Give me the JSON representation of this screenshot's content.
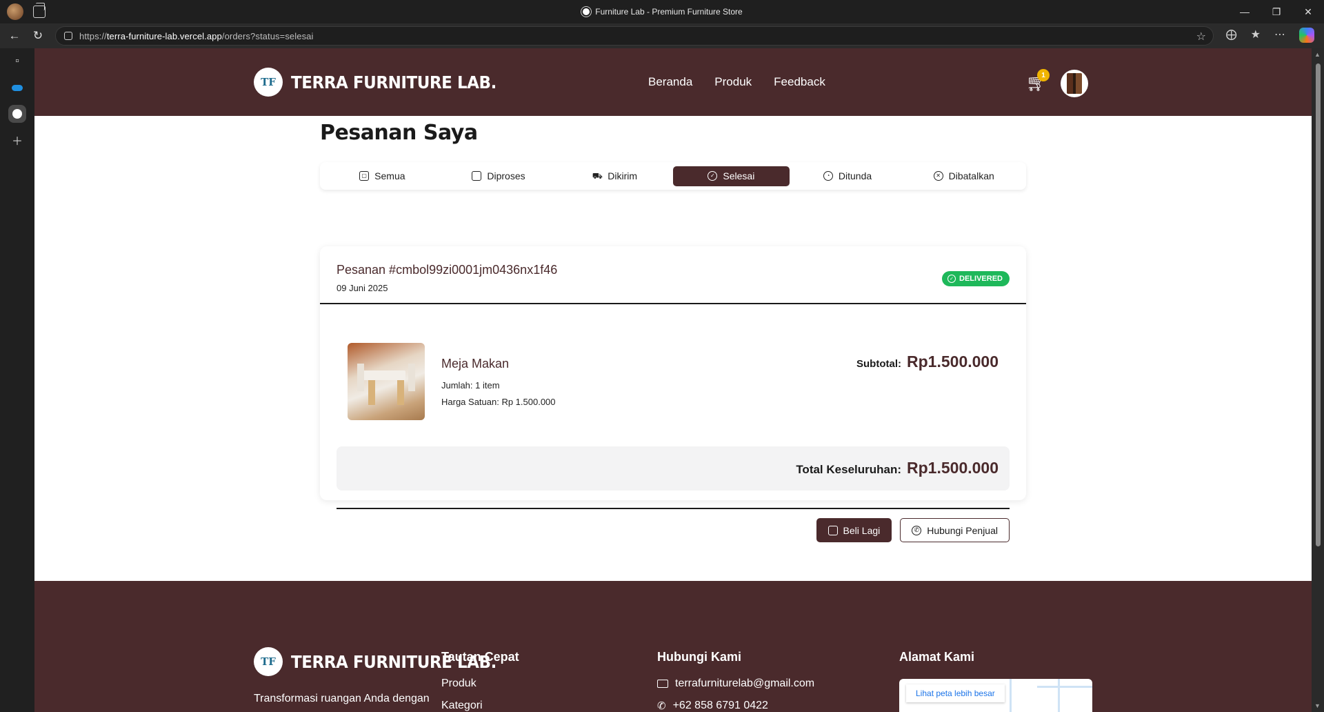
{
  "browser": {
    "tab_title": "Furniture Lab - Premium Furniture Store",
    "url_prefix": "https://",
    "url_host": "terra-furniture-lab.vercel.app",
    "url_path": "/orders?status=selesai"
  },
  "header": {
    "brand": "TERRA FURNITURE LAB.",
    "logo_mark": "TF",
    "nav": [
      "Beranda",
      "Produk",
      "Feedback"
    ],
    "cart_count": "1"
  },
  "page": {
    "title": "Pesanan Saya"
  },
  "tabs": [
    {
      "label": "Semua",
      "icon": "package-icon",
      "active": false
    },
    {
      "label": "Diproses",
      "icon": "bag-icon",
      "active": false
    },
    {
      "label": "Dikirim",
      "icon": "truck-icon",
      "active": false
    },
    {
      "label": "Selesai",
      "icon": "check-circle-icon",
      "active": true
    },
    {
      "label": "Ditunda",
      "icon": "clock-icon",
      "active": false
    },
    {
      "label": "Dibatalkan",
      "icon": "x-circle-icon",
      "active": false
    }
  ],
  "order": {
    "id_label": "Pesanan #cmbol99zi0001jm0436nx1f46",
    "date": "09 Juni 2025",
    "status": "DELIVERED",
    "status_color": "#1eb85a",
    "item": {
      "name": "Meja Makan",
      "qty": "Jumlah: 1 item",
      "unit_price": "Harga Satuan: Rp 1.500.000"
    },
    "subtotal_label": "Subtotal:",
    "subtotal_value": "Rp1.500.000",
    "total_label": "Total Keseluruhan:",
    "total_value": "Rp1.500.000",
    "buy_again": "Beli Lagi",
    "contact_seller": "Hubungi Penjual"
  },
  "footer": {
    "brand": "TERRA FURNITURE LAB.",
    "tagline": "Transformasi ruangan Anda dengan",
    "quick_links_title": "Tautan Cepat",
    "quick_links": [
      "Produk",
      "Kategori"
    ],
    "contact_title": "Hubungi Kami",
    "email": "terrafurniturelab@gmail.com",
    "phone": "+62 858 6791 0422",
    "address_title": "Alamat Kami",
    "map_link": "Lihat peta lebih besar"
  },
  "colors": {
    "brand": "#4a2a2c",
    "accent_badge": "#f0b400"
  }
}
